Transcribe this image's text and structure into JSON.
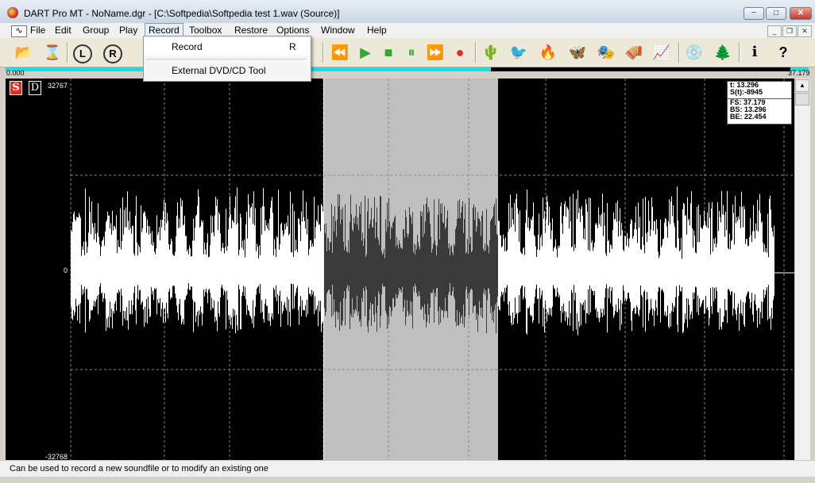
{
  "window": {
    "title": "DART Pro MT - NoName.dgr - [C:\\Softpedia\\Softpedia test 1.wav (Source)]",
    "min_glyph": "−",
    "max_glyph": "□",
    "close_glyph": "✕"
  },
  "menubar": {
    "items": [
      "File",
      "Edit",
      "Group",
      "Play",
      "Record",
      "Toolbox",
      "Restore",
      "Options",
      "Window",
      "Help"
    ],
    "active": "Record"
  },
  "dropdown": {
    "items": [
      {
        "label": "Record",
        "shortcut": "R"
      },
      {
        "label": "External DVD/CD Tool",
        "shortcut": ""
      }
    ]
  },
  "toolbar": {
    "icons": [
      "open-folder-icon",
      "hourglass-icon",
      "channel-left-icon",
      "channel-right-icon",
      "rewind-icon",
      "play-icon",
      "stop-icon",
      "pause-icon",
      "fast-forward-icon",
      "record-icon",
      "cactus-icon",
      "bird-icon",
      "flame-icon",
      "butterfly-icon",
      "mask-icon",
      "accordion-icon",
      "spectrum-icon",
      "cd-icon",
      "tree-icon",
      "info-icon",
      "help-icon"
    ],
    "left_label": "L",
    "right_label": "R"
  },
  "timeline": {
    "start": "0.000",
    "end": "37.179"
  },
  "waveform": {
    "y_max": "32767",
    "y_mid": "0",
    "y_min": "-32768",
    "s_label": "S",
    "d_label": "D",
    "info": {
      "t": "t:      13.296",
      "s": "S(t):-8945",
      "fs": "FS: 37.179",
      "bs": "BS: 13.296",
      "be": "BE: 22.454"
    },
    "colors": {
      "background": "#000000",
      "signal": "#ffffff",
      "selection": "#bfbfbf",
      "selected_signal": "#3a3a3a"
    }
  },
  "status": {
    "text": "Can be used to record a new soundfile or to modify an existing one"
  }
}
